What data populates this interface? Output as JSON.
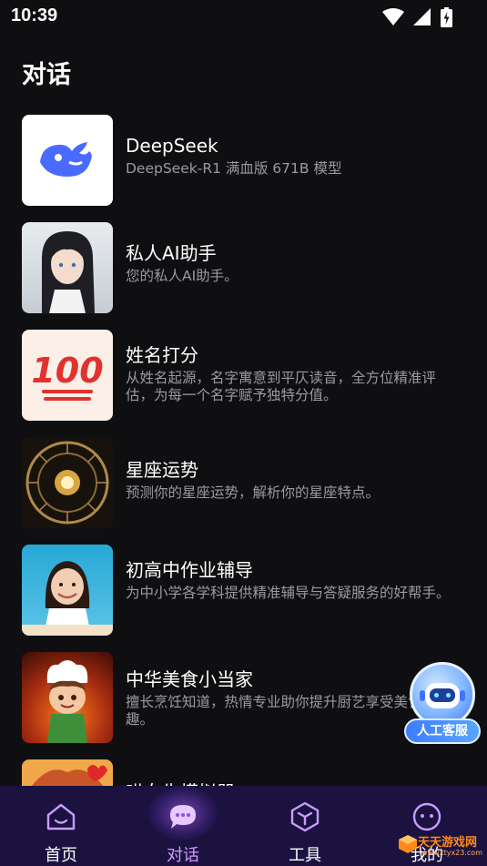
{
  "status": {
    "time": "10:39",
    "icons": [
      "wifi-icon",
      "signal-icon",
      "battery-charging-icon"
    ]
  },
  "page": {
    "title": "对话"
  },
  "items": [
    {
      "title": "DeepSeek",
      "desc": "DeepSeek-R1 满血版 671B 模型",
      "icon": "deepseek-whale-logo"
    },
    {
      "title": "私人AI助手",
      "desc": "您的私人AI助手。",
      "icon": "anime-girl-avatar"
    },
    {
      "title": "姓名打分",
      "desc": "从姓名起源，名字寓意到平仄读音，全方位精准评估，为每一个名字赋予独特分值。",
      "icon": "hundred-points-emoji",
      "thumb_text": "100"
    },
    {
      "title": "星座运势",
      "desc": "预测你的星座运势，解析你的星座特点。",
      "icon": "zodiac-wheel-image"
    },
    {
      "title": "初高中作业辅导",
      "desc": "为中小学各学科提供精准辅导与答疑服务的好帮手。",
      "icon": "student-girl-image"
    },
    {
      "title": "中华美食小当家",
      "desc": "擅长烹饪知道，热情专业助你提升厨艺享受美食乐趣。",
      "icon": "chef-boy-image"
    },
    {
      "title": "哄女生模拟器",
      "desc": "",
      "icon": "girl-avatar-image"
    }
  ],
  "floating": {
    "label": "人工客服",
    "icon": "robot-icon"
  },
  "tabs": [
    {
      "label": "首页",
      "icon": "home-icon",
      "active": false
    },
    {
      "label": "对话",
      "icon": "chat-bubble-icon",
      "active": true
    },
    {
      "label": "工具",
      "icon": "cube-icon",
      "active": false
    },
    {
      "label": "我的",
      "icon": "profile-face-icon",
      "active": false
    }
  ],
  "watermark": {
    "text": "天天游戏网",
    "sub": "www.ttyx23.com"
  },
  "colors": {
    "background": "#0f0f12",
    "tabbar": "#1b1240",
    "active_tab": "#d39cff",
    "accent_blue": "#3d7dff",
    "desc_gray": "#9a9aa2"
  }
}
